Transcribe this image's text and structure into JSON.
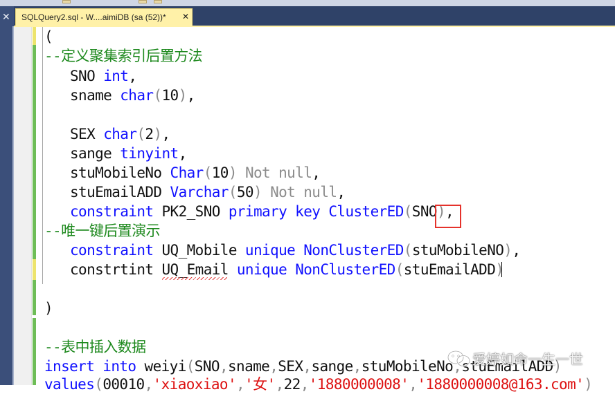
{
  "tab": {
    "title": "SQLQuery2.sql - W....aimiDB (sa (52))*",
    "close": "✕"
  },
  "left_panel": {
    "close": "✕"
  },
  "code_lines": [
    "(",
    "--定义聚集索引后置方法",
    "SNO int,",
    "sname char(10),",
    "",
    "SEX char(2),",
    "sange tinyint,",
    "stuMobileNo Char(10) Not null,",
    "stuEmailADD Varchar(50) Not null,",
    "constraint PK2_SNO primary key ClusterED(SNO),",
    "--唯一键后置演示",
    "constraint UQ_Mobile unique NonClusterED(stuMobileNO),",
    "constrtint UQ_Email unique NonClusterED(stuEmailADD)",
    "",
    ")",
    "",
    "--表中插入数据",
    "insert into weiyi(SNO,sname,SEX,sange,stuMobileNo,stuEmailADD)",
    "values(00010,'xiaoxiao','女',22,'1880000008','1880000008@163.com')"
  ],
  "watermark": {
    "text": "爱婷如命一生一世"
  },
  "colors": {
    "keyword": "#1010ff",
    "comment": "#1f8a1f",
    "gray_keyword": "#8b8b8b",
    "string": "#d11111",
    "tab_active": "#fff1a8",
    "annotation_box": "#e5322b"
  }
}
